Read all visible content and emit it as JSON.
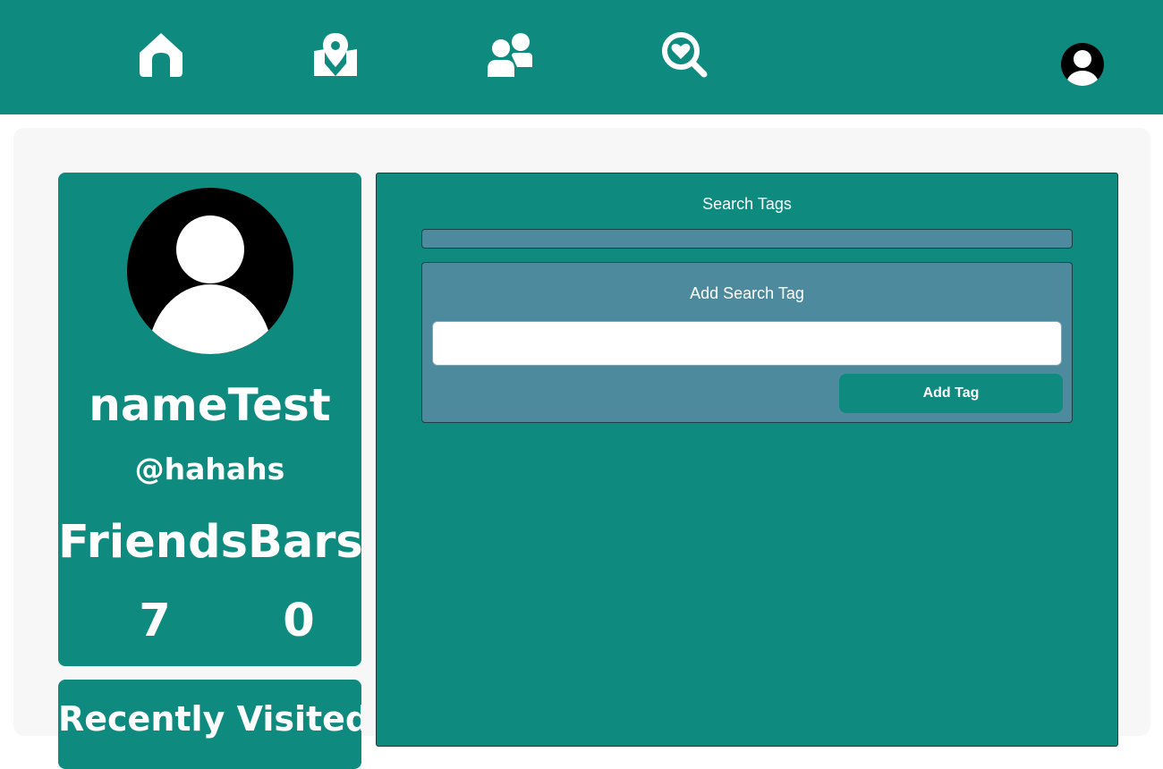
{
  "nav": {
    "items": [
      {
        "name": "home",
        "icon": "home-icon"
      },
      {
        "name": "map",
        "icon": "map-pin-icon"
      },
      {
        "name": "friends",
        "icon": "users-icon"
      },
      {
        "name": "favorites-search",
        "icon": "heart-search-icon"
      }
    ],
    "account_icon": "user-avatar-icon"
  },
  "colors": {
    "primary": "#0e8a7e",
    "secondary": "#4e8a9e",
    "panel_bg": "#f7f7f7",
    "text": "#ffffff"
  },
  "profile": {
    "name": "nameTest",
    "handle": "@hahahs",
    "stats_label": "FriendsBars",
    "friends_count": "7",
    "bars_count": "0",
    "photo_icon": "profile-avatar-icon"
  },
  "recent": {
    "title": "Recently Visited"
  },
  "tags": {
    "title": "Search Tags",
    "add_title": "Add Search Tag",
    "input_value": "",
    "add_button_label": "Add Tag"
  }
}
